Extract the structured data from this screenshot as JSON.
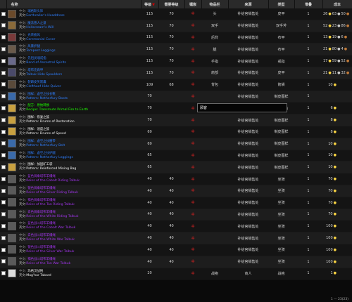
{
  "header": {
    "name": "名称",
    "level": "等级",
    "req_level": "需要等级",
    "socket": "镶嵌",
    "slot": "物品栏",
    "source": "来源",
    "type": "类型",
    "stack": "堆叠",
    "cost": "成本"
  },
  "rows": [
    {
      "zh": "瑞格斯头饰",
      "en": "Earthcaller's Headdress",
      "q": "rare",
      "lvl": "115",
      "req": "70",
      "slot": "头",
      "src": "补给官销售处",
      "type": "皮甲",
      "stack": "1",
      "g": "26",
      "s": "63",
      "c": "50",
      "ic": "#6b4a2a"
    },
    {
      "zh": "魔法兽人之意",
      "en": "Hellscream's Will",
      "q": "rare",
      "lvl": "115",
      "req": "70",
      "slot": "双手",
      "src": "补给官销售处",
      "type": "双手斧",
      "stack": "1",
      "g": "52",
      "s": "23",
      "c": "86",
      "ic": "#8a6a3a"
    },
    {
      "zh": "光荣披风",
      "en": "Ceremonial Cover",
      "q": "rare",
      "lvl": "115",
      "req": "70",
      "slot": "后背",
      "src": "补给官销售处",
      "type": "布甲",
      "stack": "1",
      "g": "13",
      "s": "19",
      "c": "6",
      "ic": "#7a3a3a"
    },
    {
      "zh": "风暴护腿",
      "en": "Tempest Leggings",
      "q": "rare",
      "lvl": "115",
      "req": "70",
      "slot": "腿",
      "src": "补给官销售处",
      "type": "布甲",
      "stack": "1",
      "g": "21",
      "s": "80",
      "c": "4",
      "ic": "#6a5a4a"
    },
    {
      "zh": "先祖灵魂戒指",
      "en": "Band of Ancestral Spirits",
      "q": "rare",
      "lvl": "115",
      "req": "70",
      "slot": "手指",
      "src": "补给官销售处",
      "type": "戒指",
      "stack": "1",
      "g": "17",
      "s": "59",
      "c": "52",
      "ic": "#6a6a8a"
    },
    {
      "zh": "塔布克肩甲",
      "en": "Talbuk Hide Spaulders",
      "q": "rare",
      "lvl": "115",
      "req": "70",
      "slot": "肩部",
      "src": "补给官销售处",
      "type": "皮甲",
      "stack": "1",
      "g": "21",
      "s": "11",
      "c": "32",
      "ic": "#4a4a6a"
    },
    {
      "zh": "裂蹄皮矢箭囊",
      "en": "Clefthoof Hide Quiver",
      "q": "rare",
      "lvl": "109",
      "req": "68",
      "slot": "背包",
      "src": "补给官销售处",
      "type": "箭袋",
      "stack": "1",
      "g": "10",
      "s": "",
      "c": "",
      "ic": "#5a4a3a"
    },
    {
      "zh": "图样：虚空之纹长靴",
      "en": "Pattern: Netherfury Boots",
      "q": "rare",
      "lvl": "70",
      "req": "",
      "slot": "",
      "src": "补给官销售处",
      "type": "制皮图样",
      "stack": "1",
      "g": "",
      "s": "",
      "c": "",
      "ic": "#3a6aaa"
    },
    {
      "zh": "配方：原始转换",
      "en": "Recipe: Transmute Primal Fire to Earth",
      "q": "uncommon",
      "lvl": "70",
      "req": "",
      "slot": "",
      "src": "补给官销售处",
      "type": "炼金配方",
      "stack": "1",
      "g": "6",
      "s": "",
      "c": "",
      "ic": "#c8a040"
    },
    {
      "zh": "图样：恢复之鼓",
      "en": "Pattern: Drums of Restoration",
      "q": "common",
      "lvl": "70",
      "req": "",
      "slot": "",
      "src": "补给官销售处",
      "type": "制皮图样",
      "stack": "1",
      "g": "8",
      "s": "",
      "c": "",
      "ic": "#c8a040"
    },
    {
      "zh": "图样：速度之鼓",
      "en": "Pattern: Drums of Speed",
      "q": "common",
      "lvl": "69",
      "req": "",
      "slot": "",
      "src": "补给官销售处",
      "type": "制皮图样",
      "stack": "1",
      "g": "8",
      "s": "",
      "c": "",
      "ic": "#c8a040"
    },
    {
      "zh": "图样：虚空之纹腰带",
      "en": "Pattern: Netherfury Belt",
      "q": "rare",
      "lvl": "69",
      "req": "",
      "slot": "",
      "src": "补给官销售处",
      "type": "制皮图样",
      "stack": "1",
      "g": "10",
      "s": "",
      "c": "",
      "ic": "#3a6aaa"
    },
    {
      "zh": "图样：虚空之纹护腿",
      "en": "Pattern: Netherfury Leggings",
      "q": "rare",
      "lvl": "65",
      "req": "",
      "slot": "",
      "src": "补给官销售处",
      "type": "制皮图样",
      "stack": "1",
      "g": "10",
      "s": "",
      "c": "",
      "ic": "#3a6aaa"
    },
    {
      "zh": "图样：加固矿工袋",
      "en": "Pattern: Reinforced Mining Bag",
      "q": "common",
      "lvl": "65",
      "req": "",
      "slot": "",
      "src": "补给官销售处",
      "type": "制皮图样",
      "stack": "1",
      "g": "10",
      "s": "",
      "c": "",
      "ic": "#c8a040"
    },
    {
      "zh": "蓝色骑乘塔布羊缰绳",
      "en": "Reins of the Cobalt Riding Talbuk",
      "q": "epic",
      "lvl": "40",
      "req": "40",
      "slot": "",
      "src": "补给官销售处",
      "type": "坐骑",
      "stack": "1",
      "g": "70",
      "s": "",
      "c": "",
      "ic": "#5a5a5a"
    },
    {
      "zh": "银色骑乘塔布羊缰绳",
      "en": "Reins of the Silver Riding Talbuk",
      "q": "epic",
      "lvl": "40",
      "req": "40",
      "slot": "",
      "src": "补给官销售处",
      "type": "坐骑",
      "stack": "1",
      "g": "70",
      "s": "",
      "c": "",
      "ic": "#5a5a5a"
    },
    {
      "zh": "褐色骑乘塔布羊缰绳",
      "en": "Reins of the Tan Riding Talbuk",
      "q": "epic",
      "lvl": "40",
      "req": "40",
      "slot": "",
      "src": "补给官销售处",
      "type": "坐骑",
      "stack": "1",
      "g": "70",
      "s": "",
      "c": "",
      "ic": "#5a5a5a"
    },
    {
      "zh": "白色骑乘塔布羊缰绳",
      "en": "Reins of the White Riding Talbuk",
      "q": "epic",
      "lvl": "40",
      "req": "40",
      "slot": "",
      "src": "补给官销售处",
      "type": "坐骑",
      "stack": "1",
      "g": "70",
      "s": "",
      "c": "",
      "ic": "#5a5a5a"
    },
    {
      "zh": "蓝色战斗塔布羊缰绳",
      "en": "Reins of the Cobalt War Talbuk",
      "q": "epic",
      "lvl": "40",
      "req": "40",
      "slot": "",
      "src": "补给官销售处",
      "type": "坐骑",
      "stack": "1",
      "g": "100",
      "s": "",
      "c": "",
      "ic": "#5a5a5a"
    },
    {
      "zh": "白色战斗塔布羊缰绳",
      "en": "Reins of the White War Talbuk",
      "q": "epic",
      "lvl": "40",
      "req": "40",
      "slot": "",
      "src": "补给官销售处",
      "type": "坐骑",
      "stack": "1",
      "g": "100",
      "s": "",
      "c": "",
      "ic": "#5a5a5a"
    },
    {
      "zh": "银色战斗塔布羊缰绳",
      "en": "Reins of the Silver War Talbuk",
      "q": "epic",
      "lvl": "40",
      "req": "40",
      "slot": "",
      "src": "补给官销售处",
      "type": "坐骑",
      "stack": "1",
      "g": "100",
      "s": "",
      "c": "",
      "ic": "#5a5a5a"
    },
    {
      "zh": "褐色战斗塔布羊缰绳",
      "en": "Reins of the Tan War Talbuk",
      "q": "epic",
      "lvl": "40",
      "req": "40",
      "slot": "",
      "src": "补给官销售处",
      "type": "坐骑",
      "stack": "1",
      "g": "100",
      "s": "",
      "c": "",
      "ic": "#5a5a5a"
    },
    {
      "zh": "玛格汉战袍",
      "en": "Mag'har Tabard",
      "q": "common",
      "lvl": "20",
      "req": "",
      "slot": "战袍",
      "src": "商人",
      "type": "战袍",
      "stack": "1",
      "g": "1",
      "s": "",
      "c": "",
      "ic": "#ddd"
    }
  ],
  "row_label_zh": "中文:",
  "row_label_en": "英文:",
  "tooltip": "顾客",
  "footer": "1 — 23(23)"
}
